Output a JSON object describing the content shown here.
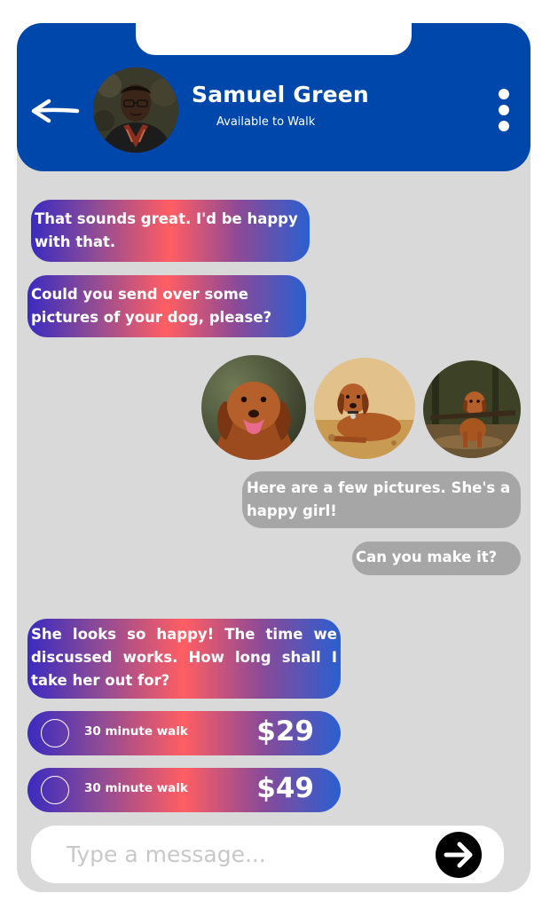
{
  "header": {
    "contact_name": "Samuel Green",
    "status": "Available to Walk",
    "back_icon": "arrow-left-icon",
    "menu_icon": "more-vertical-icon"
  },
  "messages": [
    {
      "sender": "contact",
      "text": "That sounds great. I'd be happy with that."
    },
    {
      "sender": "contact",
      "text": "Could you send over some pictures of your dog, please?"
    },
    {
      "sender": "me",
      "type": "photos",
      "photos": [
        "dog-photo-smiling",
        "dog-photo-lying",
        "dog-photo-stick"
      ]
    },
    {
      "sender": "me",
      "text": "Here are a few pictures. She's a happy girl!"
    },
    {
      "sender": "me",
      "text": "Can you make it?"
    },
    {
      "sender": "contact",
      "text": "She looks so happy! The time we discussed works. How long shall I take her out for?"
    }
  ],
  "options": [
    {
      "label": "30 minute walk",
      "price": "$29"
    },
    {
      "label": "30 minute walk",
      "price": "$49"
    }
  ],
  "composer": {
    "placeholder": "Type a message...",
    "send_icon": "arrow-right-icon"
  },
  "colors": {
    "header": "#0047ab",
    "background": "#d9d9d9",
    "outgoing_bubble": "#a6a6a6",
    "gradient_start": "#3a2bc0",
    "gradient_mid": "#ff5e62",
    "gradient_end": "#2a5fd0"
  }
}
